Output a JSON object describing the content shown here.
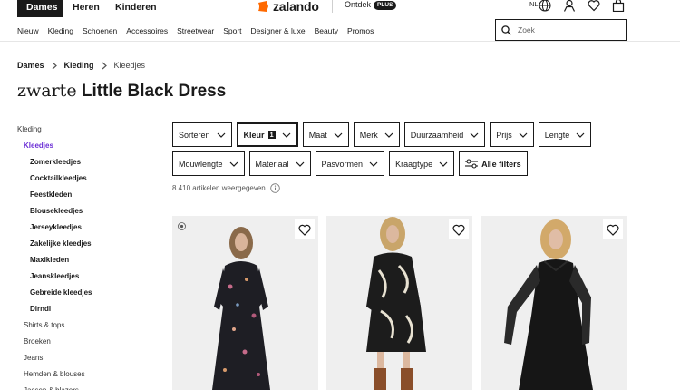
{
  "header": {
    "gender_tabs": [
      {
        "label": "Dames",
        "active": true
      },
      {
        "label": "Heren",
        "active": false
      },
      {
        "label": "Kinderen",
        "active": false
      }
    ],
    "logo_text": "zalando",
    "logo_color": "#ff6900",
    "ontdek_label": "Ontdek",
    "plus_badge": "PLUS",
    "language": "NL",
    "icons": [
      "globe-icon",
      "account-icon",
      "wishlist-icon",
      "bag-icon"
    ]
  },
  "nav": {
    "items": [
      "Nieuw",
      "Kleding",
      "Schoenen",
      "Accessoires",
      "Streetwear",
      "Sport",
      "Designer & luxe",
      "Beauty",
      "Promos"
    ],
    "search_placeholder": "Zoek"
  },
  "breadcrumb": [
    "Dames",
    "Kleding",
    "Kleedjes"
  ],
  "title": {
    "prefix": "zwarte",
    "main": "Little Black Dress"
  },
  "sidebar": {
    "root": "Kleding",
    "active": "Kleedjes",
    "accent_color": "#6b2ed6",
    "subcategories": [
      "Zomerkleedjes",
      "Cocktailkleedjes",
      "Feestkleden",
      "Blousekleedjes",
      "Jerseykleedjes",
      "Zakelijke kleedjes",
      "Maxikleden",
      "Jeanskleedjes",
      "Gebreide kleedjes",
      "Dirndl"
    ],
    "siblings": [
      "Shirts & tops",
      "Broeken",
      "Jeans",
      "Hemden & blouses",
      "Jassen & blazers"
    ]
  },
  "filters": {
    "row1": [
      {
        "label": "Sorteren"
      },
      {
        "label": "Kleur",
        "count": "1",
        "active": true
      },
      {
        "label": "Maat"
      },
      {
        "label": "Merk"
      },
      {
        "label": "Duurzaamheid"
      },
      {
        "label": "Prijs"
      },
      {
        "label": "Lengte"
      }
    ],
    "row2": [
      {
        "label": "Mouwlengte"
      },
      {
        "label": "Materiaal"
      },
      {
        "label": "Pasvormen"
      },
      {
        "label": "Kraagtype"
      }
    ],
    "all_filters": "Alle filters"
  },
  "results": {
    "count_text": "8.410 artikelen weergegeven"
  },
  "products": [
    {
      "image": "floral-maxi-dress-photo",
      "sustainability_badge": true
    },
    {
      "image": "printed-wrap-dress-photo",
      "sustainability_badge": false
    },
    {
      "image": "black-mesh-midi-dress-photo",
      "sustainability_badge": false
    }
  ]
}
